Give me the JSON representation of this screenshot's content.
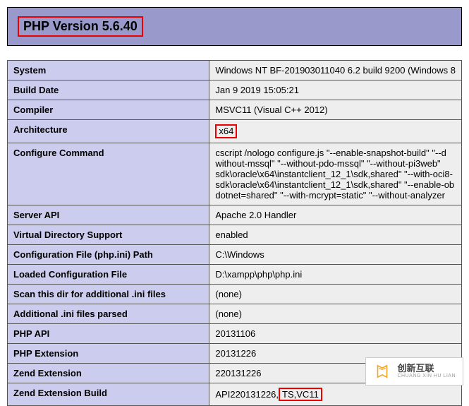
{
  "header": {
    "title": "PHP Version 5.6.40"
  },
  "rows": [
    {
      "label": "System",
      "value": "Windows NT BF-201903011040 6.2 build 9200 (Windows 8"
    },
    {
      "label": "Build Date",
      "value": "Jan 9 2019 15:05:21"
    },
    {
      "label": "Compiler",
      "value": "MSVC11 (Visual C++ 2012)"
    },
    {
      "label": "Architecture",
      "value": "x64",
      "highlight": true
    },
    {
      "label": "Configure Command",
      "value": "cscript /nologo configure.js \"--enable-snapshot-build\" \"--d\nwithout-mssql\" \"--without-pdo-mssql\" \"--without-pi3web\" \nsdk\\oracle\\x64\\instantclient_12_1\\sdk,shared\" \"--with-oci8-\nsdk\\oracle\\x64\\instantclient_12_1\\sdk,shared\" \"--enable-ob\ndotnet=shared\" \"--with-mcrypt=static\" \"--without-analyzer"
    },
    {
      "label": "Server API",
      "value": "Apache 2.0 Handler"
    },
    {
      "label": "Virtual Directory Support",
      "value": "enabled"
    },
    {
      "label": "Configuration File (php.ini) Path",
      "value": "C:\\Windows"
    },
    {
      "label": "Loaded Configuration File",
      "value": "D:\\xampp\\php\\php.ini"
    },
    {
      "label": "Scan this dir for additional .ini files",
      "value": "(none)"
    },
    {
      "label": "Additional .ini files parsed",
      "value": "(none)"
    },
    {
      "label": "PHP API",
      "value": "20131106"
    },
    {
      "label": "PHP Extension",
      "value": "20131226"
    },
    {
      "label": "Zend Extension",
      "value": "220131226"
    },
    {
      "label": "Zend Extension Build",
      "value_prefix": "API220131226,",
      "value_highlight": "TS,VC11",
      "split": true
    }
  ],
  "watermark": {
    "cn": "创新互联",
    "sub": "CHUANG XIN HU LIAN"
  }
}
